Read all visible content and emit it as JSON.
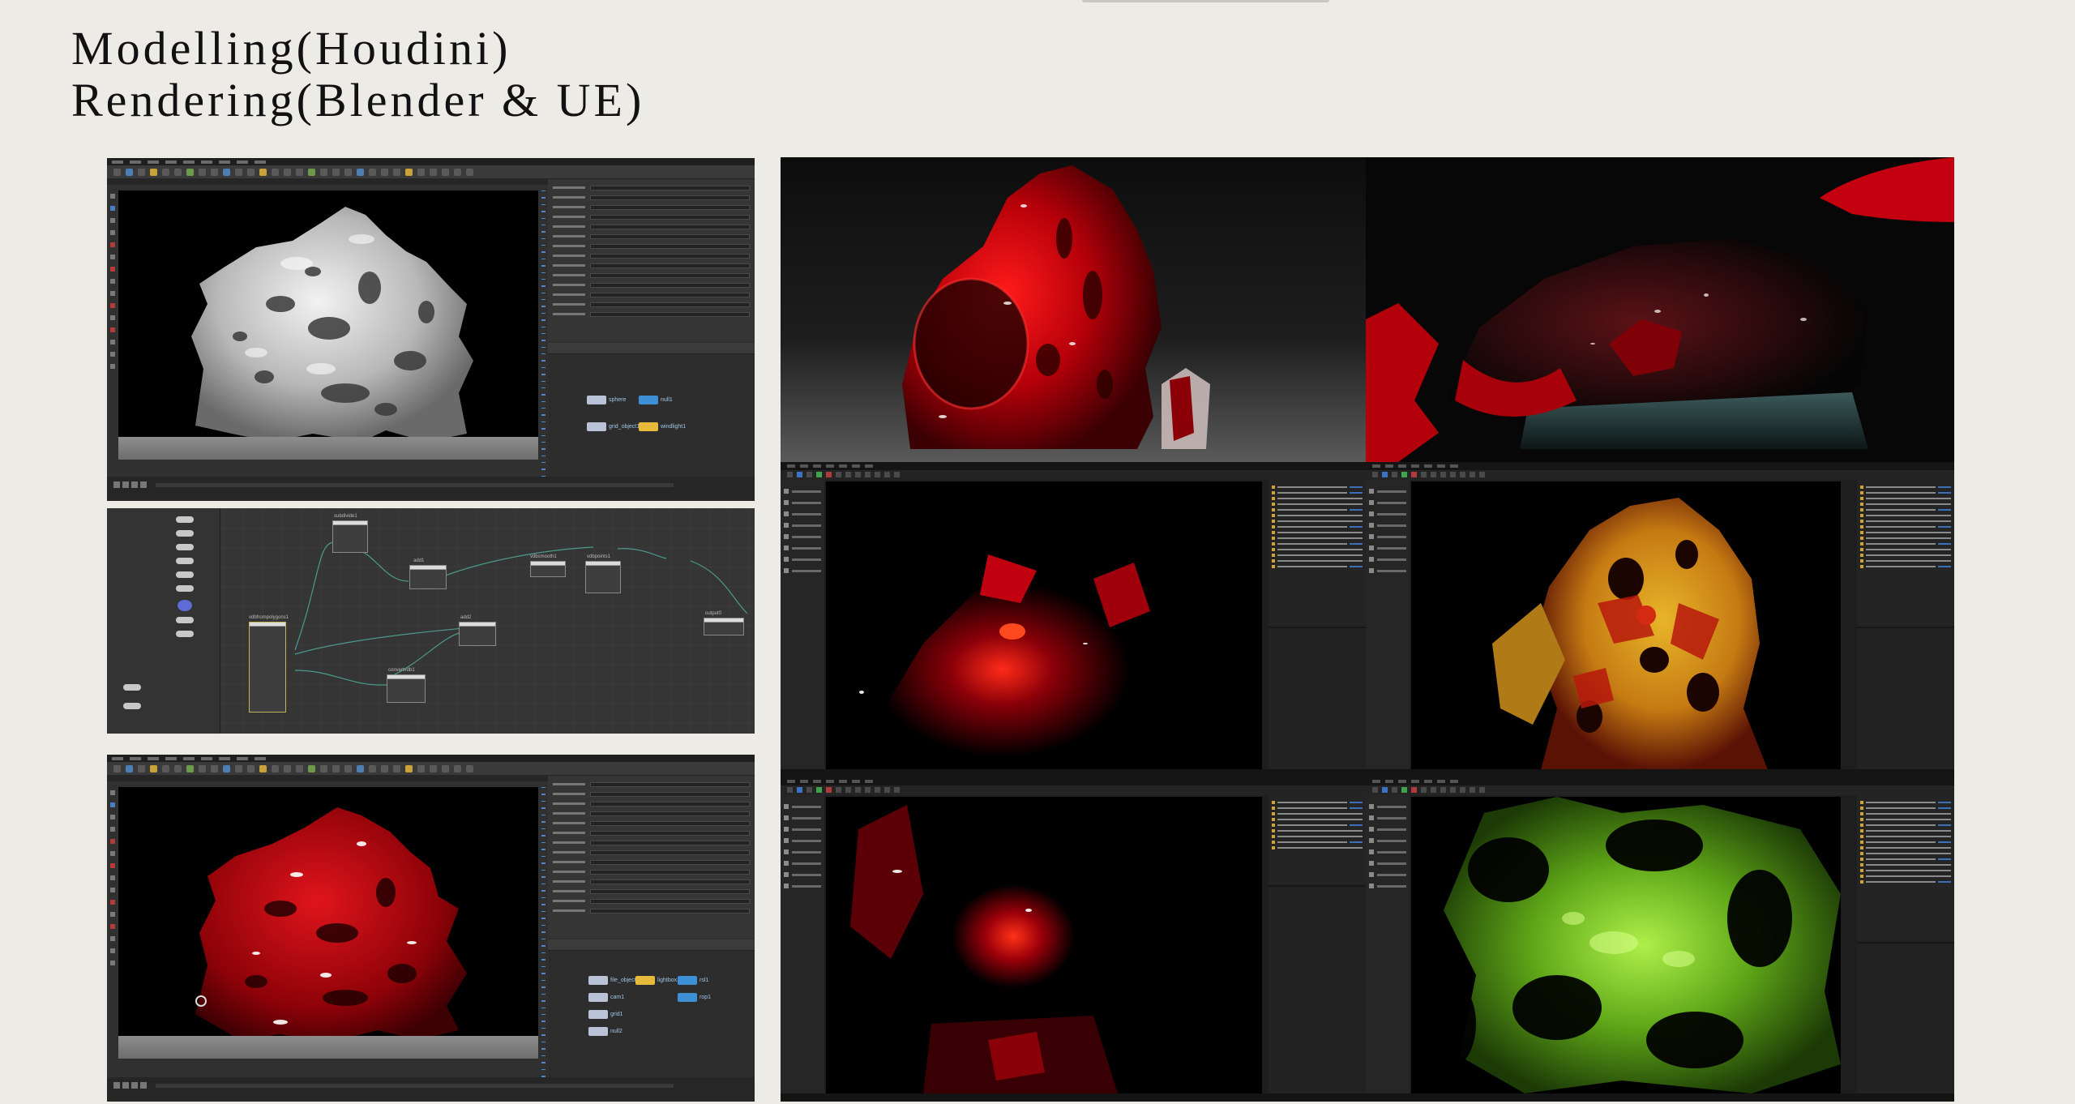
{
  "title": {
    "line1": "Modelling(Houdini)",
    "line2": "Rendering(Blender & UE)"
  },
  "houdini_top": {
    "nodes": [
      {
        "label": "sphere"
      },
      {
        "label": "null1"
      },
      {
        "label": "grid_object1"
      },
      {
        "label": "windlight1"
      }
    ]
  },
  "network_editor": {
    "nodes": [
      {
        "label": "subdivide1"
      },
      {
        "label": "add1"
      },
      {
        "label": "add2"
      },
      {
        "label": "vdbfrompolygons1"
      },
      {
        "label": "convertvdb1"
      },
      {
        "label": "vdbsmooth1"
      },
      {
        "label": "vdbpoints1"
      },
      {
        "label": "output0"
      }
    ]
  },
  "houdini_bottom": {
    "nodes": [
      {
        "label": "file_object1"
      },
      {
        "label": "lightbox1"
      },
      {
        "label": "rsl1"
      },
      {
        "label": "cam1"
      },
      {
        "label": "grid1"
      },
      {
        "label": "null2"
      },
      {
        "label": "rop1"
      }
    ]
  },
  "colors": {
    "background": "#edebe6",
    "houdini_ui": "#303030",
    "unreal_ui": "#1e1e1e",
    "render_red": "#c0121c",
    "render_yellow": "#e0b52a",
    "render_green": "#7fd321"
  }
}
